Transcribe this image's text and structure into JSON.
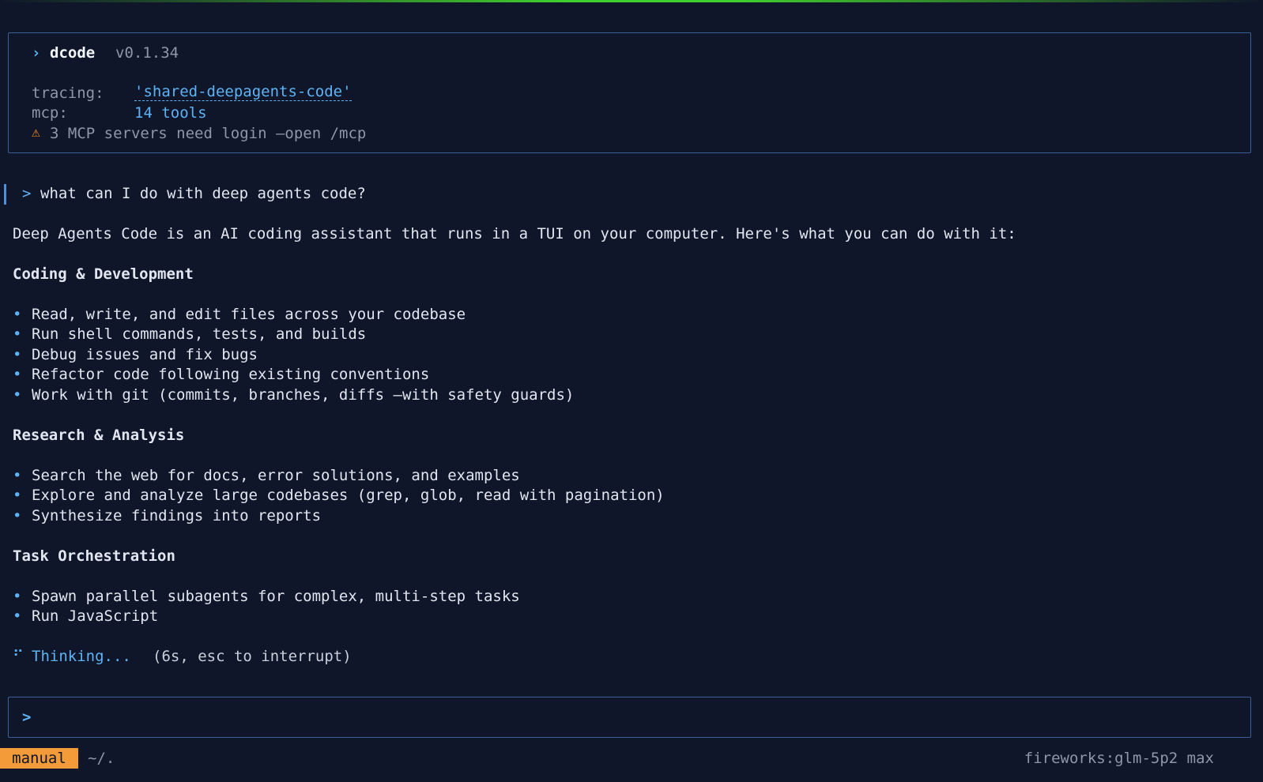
{
  "header": {
    "prompt_glyph": "›",
    "app_name": "dcode",
    "version": "v0.1.34",
    "tracing_label": "tracing:",
    "tracing_value": "'shared-deepagents-code'",
    "mcp_label": "mcp:",
    "mcp_value": "14 tools",
    "warning_icon": "⚠",
    "warning_text": "3 MCP servers need login —open /mcp"
  },
  "conversation": {
    "user_prompt_glyph": ">",
    "user_message": "what can I do with deep agents code?",
    "intro": "Deep Agents Code is an AI coding assistant that runs in a TUI on your computer. Here's what you can do with it:",
    "bullet_glyph": "•",
    "sections": [
      {
        "heading": "Coding & Development",
        "items": [
          "Read, write, and edit files across your codebase",
          "Run shell commands, tests, and builds",
          "Debug issues and fix bugs",
          "Refactor code following existing conventions",
          "Work with git (commits, branches, diffs —with safety guards)"
        ]
      },
      {
        "heading": "Research & Analysis",
        "items": [
          "Search the web for docs, error solutions, and examples",
          "Explore and analyze large codebases (grep, glob, read with pagination)",
          "Synthesize findings into reports"
        ]
      },
      {
        "heading": "Task Orchestration",
        "items": [
          "Spawn parallel subagents for complex, multi-step tasks",
          "Run JavaScript"
        ]
      }
    ]
  },
  "status": {
    "spinner_icon": "⠋",
    "thinking_label": "Thinking...",
    "thinking_hint": "(6s, esc to interrupt)"
  },
  "input": {
    "prompt_glyph": ">",
    "value": ""
  },
  "footer": {
    "mode": "manual",
    "cwd": "~/.",
    "model": "fireworks:glm-5p2 max"
  },
  "colors": {
    "background": "#0f1629",
    "accent_blue": "#5eb3f5",
    "border": "#3b5f94",
    "mode_badge": "#f29b38",
    "warning": "#ff8c1a"
  }
}
